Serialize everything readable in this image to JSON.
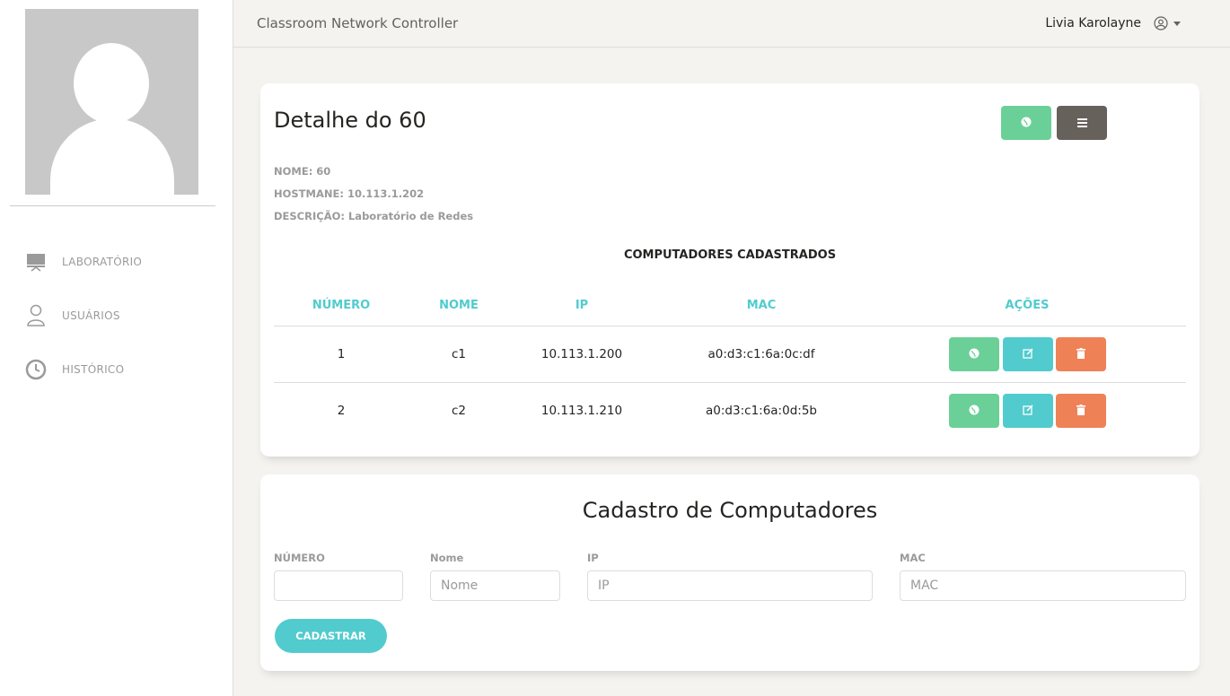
{
  "header": {
    "brand": "Classroom Network Controller",
    "user_name": "Livia Karolayne"
  },
  "sidebar": {
    "items": [
      {
        "label": "LABORATÓRIO",
        "icon": "monitor-icon"
      },
      {
        "label": "USUÁRIOS",
        "icon": "user-icon"
      },
      {
        "label": "HISTÓRICO",
        "icon": "clock-icon"
      }
    ]
  },
  "detail": {
    "title": "Detalhe do 60",
    "nome": "NOME: 60",
    "hostname": "HOSTMANE: 10.113.1.202",
    "descricao": "DESCRIÇÃO: Laboratório de Redes",
    "section_title": "COMPUTADORES CADASTRADOS",
    "columns": [
      "NÚMERO",
      "NOME",
      "IP",
      "MAC",
      "AÇÕES"
    ],
    "rows": [
      {
        "numero": "1",
        "nome": "c1",
        "ip": "10.113.1.200",
        "mac": "a0:d3:c1:6a:0c:df"
      },
      {
        "numero": "2",
        "nome": "c2",
        "ip": "10.113.1.210",
        "mac": "a0:d3:c1:6a:0d:5b"
      }
    ]
  },
  "form": {
    "title": "Cadastro de Computadores",
    "numero_label": "NÚMERO",
    "numero_value": "",
    "nome_label": "Nome",
    "nome_placeholder": "Nome",
    "ip_label": "IP",
    "ip_placeholder": "IP",
    "mac_label": "MAC",
    "mac_placeholder": "MAC",
    "submit_label": "CADASTRAR"
  },
  "colors": {
    "green": "#6bd098",
    "dark": "#66615b",
    "info": "#51cbce",
    "danger": "#ef8157"
  }
}
